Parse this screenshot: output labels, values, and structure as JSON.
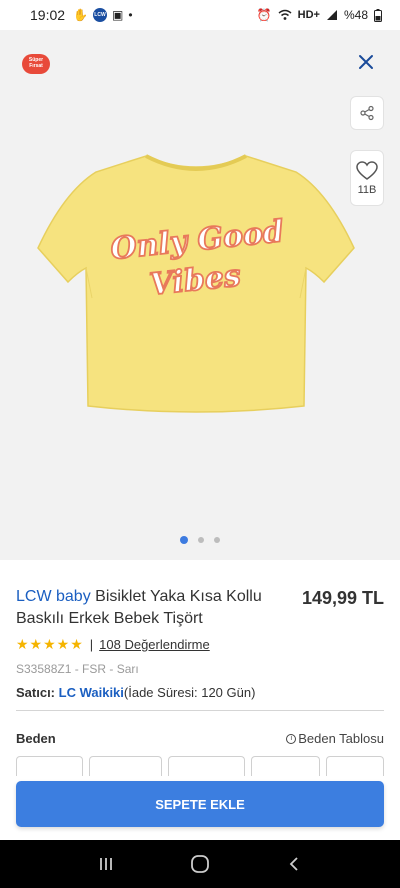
{
  "status_bar": {
    "time": "19:02",
    "network": "HD+",
    "battery": "%48",
    "app_badge": "LCW"
  },
  "image": {
    "badge_text": "Süper Fırsat",
    "favorite_count": "11B",
    "print_text_line1": "Only Good",
    "print_text_line2": "Vibes",
    "carousel_total": 3,
    "carousel_active": 1,
    "shirt_color": "#f6e37f"
  },
  "product": {
    "brand": "LCW baby",
    "name": " Bisiklet Yaka Kısa Kollu Baskılı Erkek Bebek Tişört",
    "price": "149,99 TL",
    "rating_stars": "★★★★★",
    "rating_value": 5,
    "reviews_label": "108 Değerlendirme",
    "sku": "S33588Z1 - FSR - Sarı",
    "seller_label": "Satıcı:",
    "seller_name": "LC Waikiki",
    "return_policy": "(İade Süresi: 120 Gün)"
  },
  "size": {
    "label": "Beden",
    "table_link": "Beden Tablosu"
  },
  "actions": {
    "add_to_cart": "SEPETE EKLE"
  },
  "colors": {
    "accent": "#3c7ee0",
    "brand_blue": "#1b5fc1",
    "star": "#f5b400"
  }
}
